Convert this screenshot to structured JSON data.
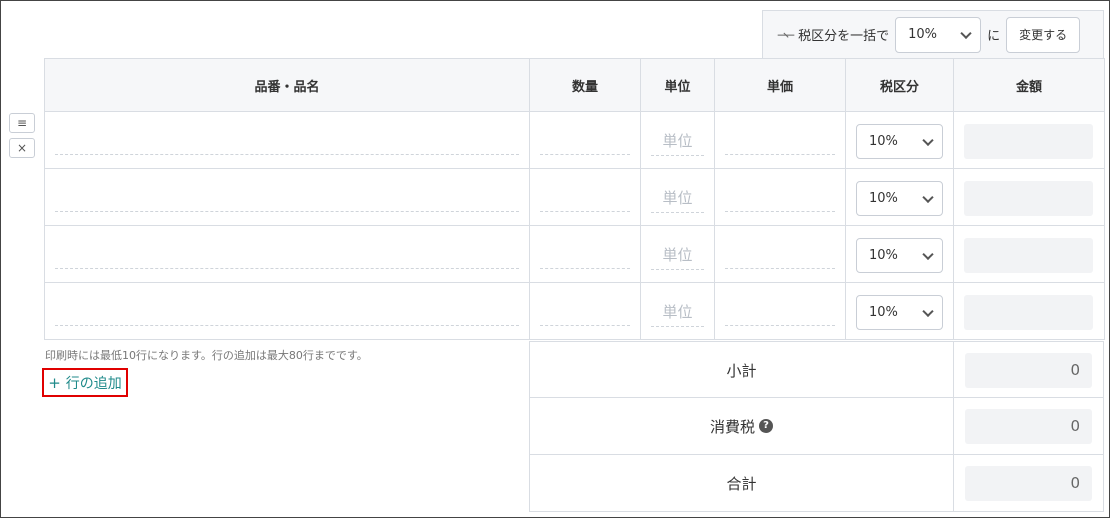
{
  "bulk": {
    "icon": "swap-arrows-icon",
    "label": "税区分を一括で",
    "selected": "10%",
    "suffix": "に",
    "button": "変更する"
  },
  "columns": [
    "品番・品名",
    "数量",
    "単位",
    "単価",
    "税区分",
    "金額"
  ],
  "row_controls": {
    "menu_icon": "hamburger-icon",
    "menu_glyph": "≡",
    "delete_icon": "close-icon",
    "delete_glyph": "×"
  },
  "rows": [
    {
      "unit_placeholder": "単位",
      "tax": "10%"
    },
    {
      "unit_placeholder": "単位",
      "tax": "10%"
    },
    {
      "unit_placeholder": "単位",
      "tax": "10%"
    },
    {
      "unit_placeholder": "単位",
      "tax": "10%"
    }
  ],
  "note": "印刷時には最低10行になります。行の追加は最大80行までです。",
  "add_row": {
    "icon": "plus-icon",
    "glyph": "+",
    "label": "行の追加"
  },
  "summary": {
    "subtotal_label": "小計",
    "subtotal": "0",
    "tax_label": "消費税",
    "tax_help_glyph": "?",
    "tax": "0",
    "total_label": "合計",
    "total": "0"
  }
}
